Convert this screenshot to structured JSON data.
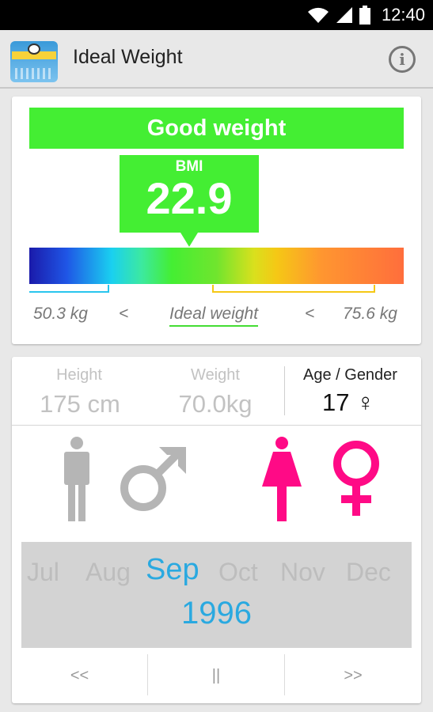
{
  "status_bar": {
    "time": "12:40"
  },
  "action_bar": {
    "title": "Ideal Weight"
  },
  "result": {
    "status": "Good weight",
    "bmi_label": "BMI",
    "bmi_value": "22.9",
    "low_weight": "50.3 kg",
    "less_than_1": "<",
    "ideal_label": "Ideal weight",
    "less_than_2": "<",
    "high_weight": "75.6 kg"
  },
  "inputs": {
    "height_label": "Height",
    "height_value": "175 cm",
    "weight_label": "Weight",
    "weight_value": "70.0kg",
    "age_label": "Age / Gender",
    "age_value": "17 ♀"
  },
  "date_picker": {
    "months": [
      "Jul",
      "Aug",
      "Sep",
      "Oct",
      "Nov",
      "Dec"
    ],
    "selected_month": "Sep",
    "year": "1996"
  },
  "navigation": {
    "prev": "<<",
    "pause": "||",
    "next": ">>"
  },
  "colors": {
    "good": "#44ee33",
    "female": "#ff0a86",
    "inactive": "#b5b5b5",
    "selected_text": "#2aa9e0"
  }
}
